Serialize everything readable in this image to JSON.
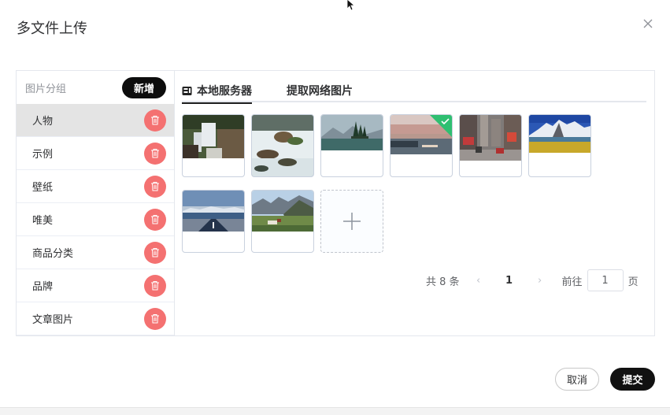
{
  "dialog": {
    "title": "多文件上传"
  },
  "sidebar": {
    "title": "图片分组",
    "add_label": "新增",
    "items": [
      {
        "label": "人物",
        "active": true
      },
      {
        "label": "示例"
      },
      {
        "label": "壁纸"
      },
      {
        "label": "唯美"
      },
      {
        "label": "商品分类"
      },
      {
        "label": "品牌"
      },
      {
        "label": "文章图片"
      }
    ]
  },
  "tabs": [
    {
      "label": "本地服务器",
      "icon": "server-icon",
      "active": true
    },
    {
      "label": "提取网络图片"
    }
  ],
  "images": [
    {
      "name": "waterfall-rocks",
      "selected": false
    },
    {
      "name": "river-rapids",
      "selected": false
    },
    {
      "name": "lake-island-trees",
      "selected": false
    },
    {
      "name": "sunset-sea",
      "selected": true
    },
    {
      "name": "city-street",
      "selected": false
    },
    {
      "name": "mountain-lake",
      "selected": false
    },
    {
      "name": "empty-road",
      "selected": false
    },
    {
      "name": "alpine-valley",
      "selected": false
    }
  ],
  "pagination": {
    "total_text": "共 8 条",
    "current_page": "1",
    "goto_prefix": "前往",
    "goto_value": "1",
    "goto_suffix": "页"
  },
  "footer": {
    "cancel_label": "取消",
    "submit_label": "提交"
  },
  "colors": {
    "accent": "#111111",
    "delete": "#f47171",
    "selected": "#2fbf71"
  }
}
